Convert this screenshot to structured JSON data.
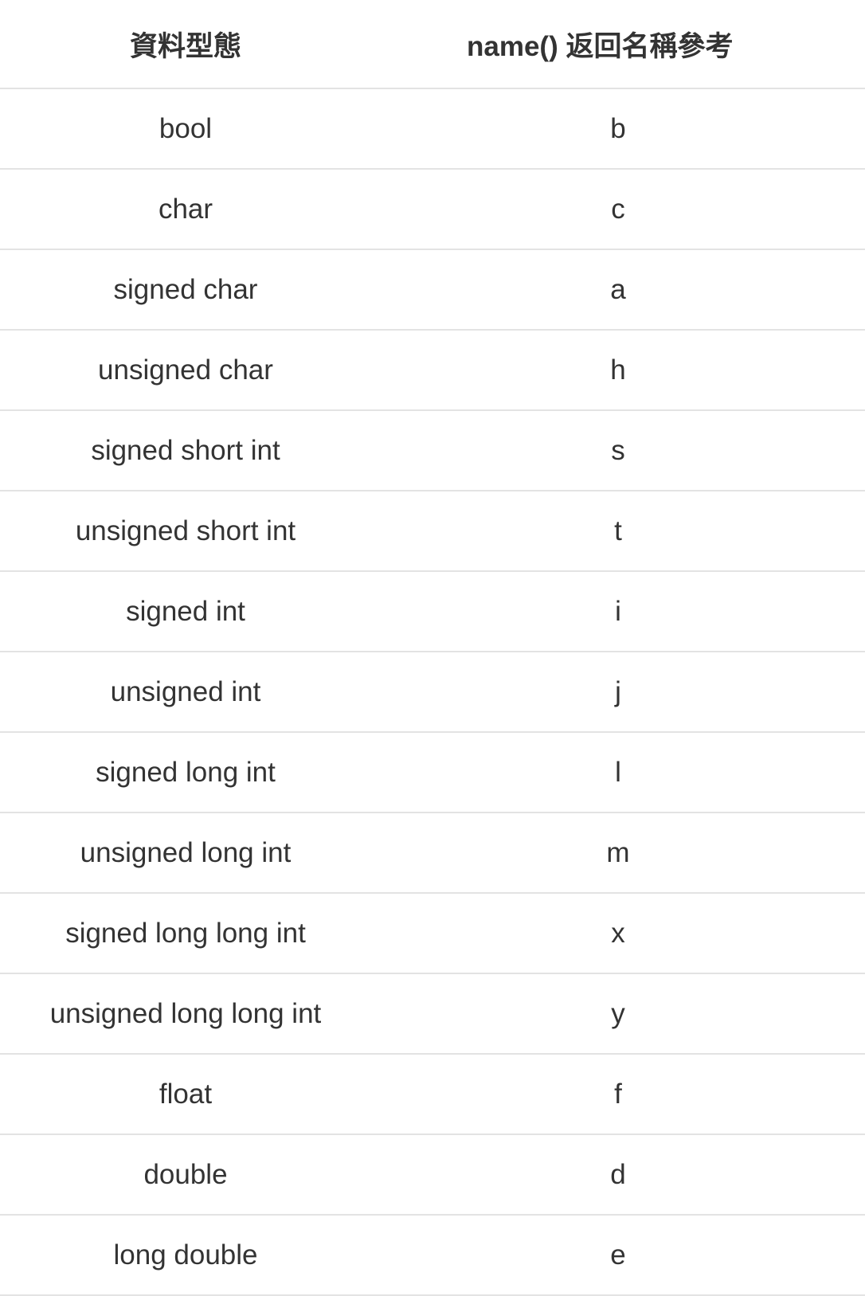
{
  "table": {
    "headers": [
      "資料型態",
      "name() 返回名稱參考"
    ],
    "rows": [
      [
        "bool",
        "b"
      ],
      [
        "char",
        "c"
      ],
      [
        "signed char",
        "a"
      ],
      [
        "unsigned char",
        "h"
      ],
      [
        "signed short int",
        "s"
      ],
      [
        "unsigned short int",
        "t"
      ],
      [
        "signed int",
        "i"
      ],
      [
        "unsigned int",
        "j"
      ],
      [
        "signed long int",
        "l"
      ],
      [
        "unsigned long int",
        "m"
      ],
      [
        "signed long long int",
        "x"
      ],
      [
        "unsigned long long int",
        "y"
      ],
      [
        "float",
        "f"
      ],
      [
        "double",
        "d"
      ],
      [
        "long double",
        "e"
      ]
    ]
  }
}
